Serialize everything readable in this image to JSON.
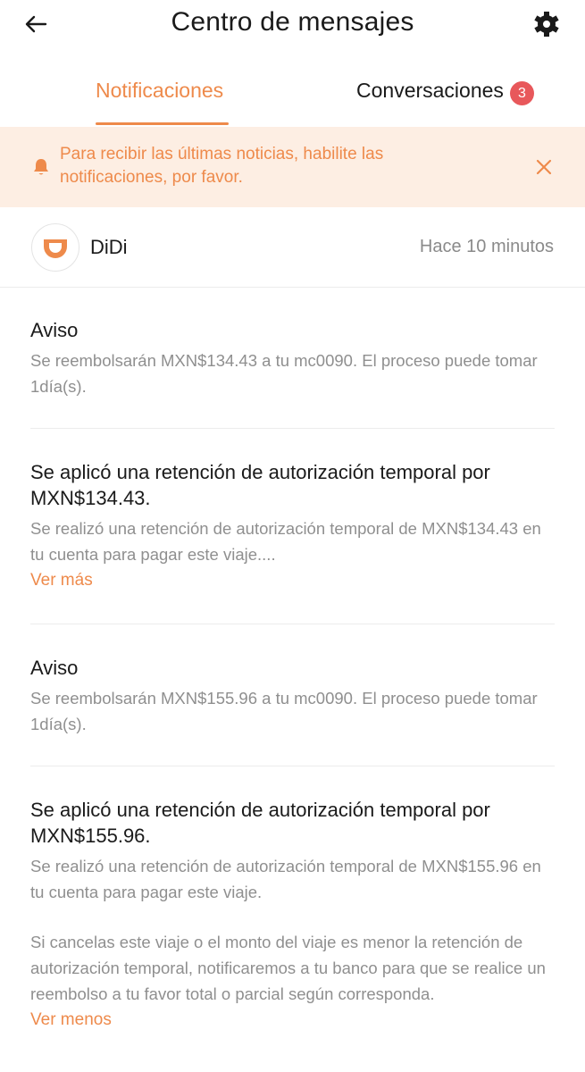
{
  "header": {
    "title": "Centro de mensajes",
    "back_icon": "arrow-left-icon",
    "settings_icon": "gear-icon"
  },
  "tabs": [
    {
      "label": "Notificaciones",
      "active": true
    },
    {
      "label": "Conversaciones",
      "active": false,
      "badge": "3"
    }
  ],
  "banner": {
    "text": "Para recibir las últimas noticias, habilite las notificaciones, por favor.",
    "icon": "bell-icon",
    "close_icon": "close-icon"
  },
  "sender": {
    "name": "DiDi",
    "time": "Hace 10 minutos",
    "logo": "didi-logo-icon"
  },
  "messages": [
    {
      "title": "Aviso",
      "body": "Se reembolsarán MXN$134.43 a tu mc0090. El proceso puede tomar 1día(s)."
    },
    {
      "title": "Se aplicó una retención de autorización temporal por MXN$134.43.",
      "body": "Se realizó una retención de autorización temporal de MXN$134.43 en tu cuenta para pagar este viaje....",
      "link": "Ver más"
    },
    {
      "title": "Aviso",
      "body": "Se reembolsarán MXN$155.96 a tu mc0090. El proceso puede tomar 1día(s)."
    },
    {
      "title": "Se aplicó una retención de autorización temporal por MXN$155.96.",
      "body": "Se realizó una retención de autorización temporal de MXN$155.96 en tu cuenta para pagar este viaje.",
      "body_extra": "Si cancelas este viaje o el monto del viaje es menor la retención de autorización temporal, notificaremos a tu banco para que se realice un reembolso a tu favor total o parcial según corresponda.",
      "link": "Ver menos"
    }
  ],
  "colors": {
    "accent": "#ee8a4b",
    "banner_bg": "#fdeee3",
    "badge": "#e8585b",
    "muted_text": "#8f8f8f"
  }
}
